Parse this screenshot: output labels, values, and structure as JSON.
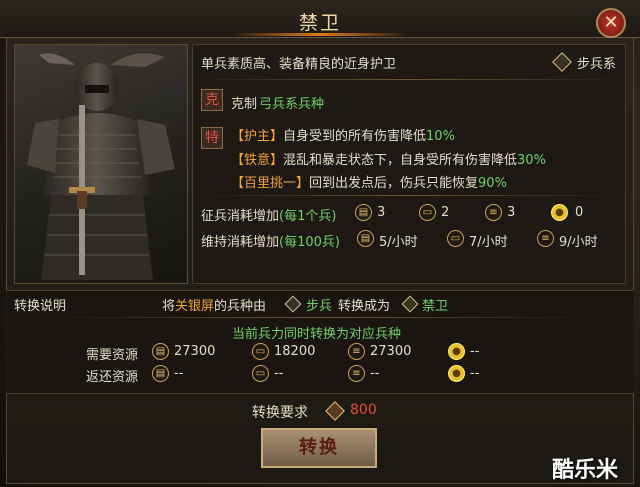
{
  "title": "禁卫",
  "close": "✕",
  "unit": {
    "description": "单兵素质高、装备精良的近身护卫",
    "category": "步兵系",
    "counter_badge": "克",
    "counter_prefix": "克制",
    "counter_target": "弓兵系兵种",
    "trait_badge": "特",
    "traits": [
      {
        "name": "【护主】",
        "text": "自身受到的所有伤害降低",
        "value": "10%"
      },
      {
        "name": "【铁意】",
        "text": "混乱和暴走状态下，自身受所有伤害降低",
        "value": "30%"
      },
      {
        "name": "【百里挑一】",
        "text": "回到出发点后，伤兵只能恢复",
        "value": "90%"
      }
    ],
    "recruit_label": "征兵消耗增加",
    "recruit_unit": "(每1个兵)",
    "recruit_costs": [
      "3",
      "2",
      "3",
      "0"
    ],
    "upkeep_label": "维持消耗增加",
    "upkeep_unit": "(每100兵)",
    "upkeep_costs": [
      "5/小时",
      "7/小时",
      "9/小时"
    ]
  },
  "conversion": {
    "heading": "转换说明",
    "line_pre": "将",
    "hero": "关银屏",
    "line_mid": "的兵种由",
    "from": "步兵",
    "line_to": "转换成为",
    "to": "禁卫",
    "note": "当前兵力同时转换为对应兵种",
    "need_label": "需要资源",
    "need": [
      "27300",
      "18200",
      "27300",
      "--"
    ],
    "return_label": "返还资源",
    "return": [
      "--",
      "--",
      "--",
      "--"
    ]
  },
  "requirement_label": "转换要求",
  "requirement_value": "800",
  "convert_button": "转换",
  "watermark": "酷乐米",
  "colors": {
    "accent": "#6fd06a",
    "highlight": "#f0a23c",
    "requirement": "#e84a3a"
  }
}
